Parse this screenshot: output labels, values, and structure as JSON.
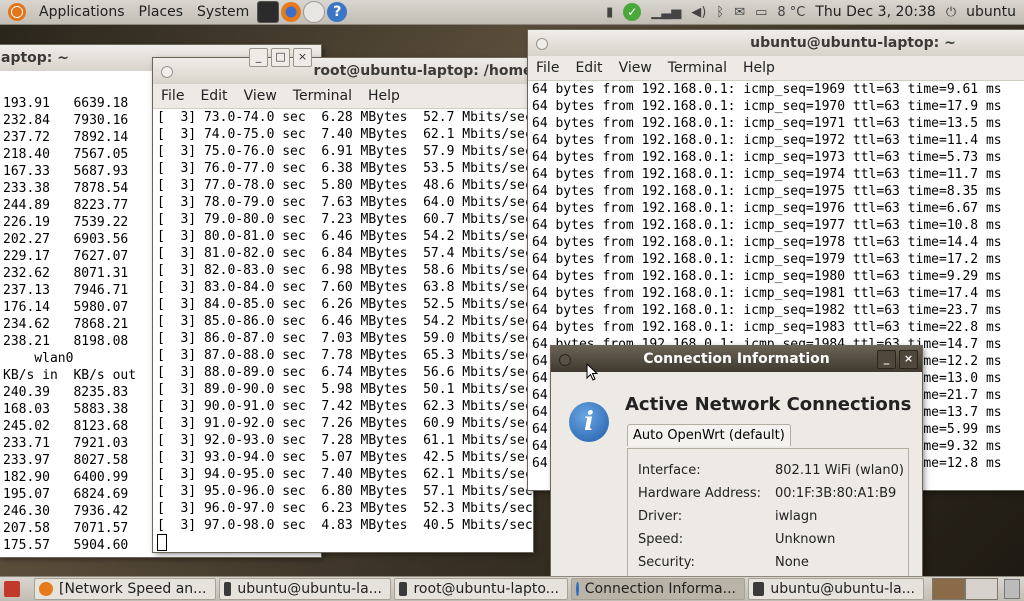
{
  "top_panel": {
    "menus": [
      "Applications",
      "Places",
      "System"
    ],
    "weather": "8 °C",
    "clock": "Thu Dec  3, 20:38",
    "user": "ubuntu"
  },
  "left_window": {
    "title": "aptop: ~",
    "lines": [
      "193.91   6639.18",
      "232.84   7930.16",
      "237.72   7892.14",
      "218.40   7567.05",
      "167.33   5687.93",
      "233.38   7878.54",
      "244.89   8223.77",
      "226.19   7539.22",
      "202.27   6903.56",
      "229.17   7627.07",
      "232.62   8071.31",
      "237.13   7946.71",
      "176.14   5980.07",
      "234.62   7868.21",
      "238.21   8198.08",
      "    wlan0",
      "KB/s in  KB/s out",
      "240.39   8235.83",
      "168.03   5883.38",
      "245.02   8123.68",
      "233.71   7921.03",
      "233.97   8027.58",
      "182.90   6400.99",
      "195.07   6824.69",
      "246.30   7936.42",
      "207.58   7071.57",
      "175.57   5904.60"
    ]
  },
  "middle_window": {
    "title": "root@ubuntu-laptop: /home",
    "menu": [
      "File",
      "Edit",
      "View",
      "Terminal",
      "Help"
    ],
    "lines": [
      "[  3] 73.0-74.0 sec  6.28 MBytes  52.7 Mbits/sec",
      "[  3] 74.0-75.0 sec  7.40 MBytes  62.1 Mbits/sec",
      "[  3] 75.0-76.0 sec  6.91 MBytes  57.9 Mbits/sec",
      "[  3] 76.0-77.0 sec  6.38 MBytes  53.5 Mbits/sec",
      "[  3] 77.0-78.0 sec  5.80 MBytes  48.6 Mbits/sec",
      "[  3] 78.0-79.0 sec  7.63 MBytes  64.0 Mbits/sec",
      "[  3] 79.0-80.0 sec  7.23 MBytes  60.7 Mbits/sec",
      "[  3] 80.0-81.0 sec  6.46 MBytes  54.2 Mbits/sec",
      "[  3] 81.0-82.0 sec  6.84 MBytes  57.4 Mbits/sec",
      "[  3] 82.0-83.0 sec  6.98 MBytes  58.6 Mbits/sec",
      "[  3] 83.0-84.0 sec  7.60 MBytes  63.8 Mbits/sec",
      "[  3] 84.0-85.0 sec  6.26 MBytes  52.5 Mbits/sec",
      "[  3] 85.0-86.0 sec  6.46 MBytes  54.2 Mbits/sec",
      "[  3] 86.0-87.0 sec  7.03 MBytes  59.0 Mbits/sec",
      "[  3] 87.0-88.0 sec  7.78 MBytes  65.3 Mbits/sec",
      "[  3] 88.0-89.0 sec  6.74 MBytes  56.6 Mbits/sec",
      "[  3] 89.0-90.0 sec  5.98 MBytes  50.1 Mbits/sec",
      "[  3] 90.0-91.0 sec  7.42 MBytes  62.3 Mbits/sec",
      "[  3] 91.0-92.0 sec  7.26 MBytes  60.9 Mbits/sec",
      "[  3] 92.0-93.0 sec  7.28 MBytes  61.1 Mbits/sec",
      "[  3] 93.0-94.0 sec  5.07 MBytes  42.5 Mbits/sec",
      "[  3] 94.0-95.0 sec  7.40 MBytes  62.1 Mbits/sec",
      "[  3] 95.0-96.0 sec  6.80 MBytes  57.1 Mbits/sec",
      "[  3] 96.0-97.0 sec  6.23 MBytes  52.3 Mbits/sec",
      "[  3] 97.0-98.0 sec  4.83 MBytes  40.5 Mbits/sec"
    ]
  },
  "right_window": {
    "title": "ubuntu@ubuntu-laptop: ~",
    "menu": [
      "File",
      "Edit",
      "View",
      "Terminal",
      "Help"
    ],
    "lines": [
      "64 bytes from 192.168.0.1: icmp_seq=1969 ttl=63 time=9.61 ms",
      "64 bytes from 192.168.0.1: icmp_seq=1970 ttl=63 time=17.9 ms",
      "64 bytes from 192.168.0.1: icmp_seq=1971 ttl=63 time=13.5 ms",
      "64 bytes from 192.168.0.1: icmp_seq=1972 ttl=63 time=11.4 ms",
      "64 bytes from 192.168.0.1: icmp_seq=1973 ttl=63 time=5.73 ms",
      "64 bytes from 192.168.0.1: icmp_seq=1974 ttl=63 time=11.7 ms",
      "64 bytes from 192.168.0.1: icmp_seq=1975 ttl=63 time=8.35 ms",
      "64 bytes from 192.168.0.1: icmp_seq=1976 ttl=63 time=6.67 ms",
      "64 bytes from 192.168.0.1: icmp_seq=1977 ttl=63 time=10.8 ms",
      "64 bytes from 192.168.0.1: icmp_seq=1978 ttl=63 time=14.4 ms",
      "64 bytes from 192.168.0.1: icmp_seq=1979 ttl=63 time=17.2 ms",
      "64 bytes from 192.168.0.1: icmp_seq=1980 ttl=63 time=9.29 ms",
      "64 bytes from 192.168.0.1: icmp_seq=1981 ttl=63 time=17.4 ms",
      "64 bytes from 192.168.0.1: icmp_seq=1982 ttl=63 time=23.7 ms",
      "64 bytes from 192.168.0.1: icmp_seq=1983 ttl=63 time=22.8 ms",
      "64 bytes from 192.168.0.1: icmp_seq=1984 ttl=63 time=14.7 ms",
      "64 bytes from 192.168.0.1: icmp_seq=1985 ttl=63 time=12.2 ms",
      "64 bytes from 192.168.0.1: icmp_seq=1986 ttl=63 time=13.0 ms",
      "64 bytes from 192.168.0.1: icmp_seq=1987 ttl=63 time=21.7 ms",
      "64 bytes from 192.168.0.1: icmp_seq=1988 ttl=63 time=13.7 ms",
      "64 bytes from 192.168.0.1: icmp_seq=1989 ttl=63 time=5.99 ms",
      "64 bytes from 192.168.0.1: icmp_seq=1990 ttl=63 time=9.32 ms",
      "64 bytes from 192.168.0.1: icmp_seq=1991 ttl=63 time=12.8 ms"
    ]
  },
  "dialog": {
    "title": "Connection Information",
    "heading": "Active Network Connections",
    "tab": "Auto OpenWrt (default)",
    "fields": [
      {
        "label": "Interface:",
        "value": "802.11 WiFi (wlan0)"
      },
      {
        "label": "Hardware Address:",
        "value": "00:1F:3B:80:A1:B9"
      },
      {
        "label": "Driver:",
        "value": "iwlagn"
      },
      {
        "label": "Speed:",
        "value": "Unknown"
      },
      {
        "label": "Security:",
        "value": "None"
      }
    ]
  },
  "taskbar": {
    "items": [
      "[Network Speed an...",
      "ubuntu@ubuntu-la...",
      "root@ubuntu-lapto...",
      "Connection Informa...",
      "ubuntu@ubuntu-la..."
    ]
  },
  "colors": {
    "panel": "#d6d2cb",
    "active_titlebar": "#4a4237",
    "info_blue": "#2f6fbe",
    "ubuntu_orange": "#e2761b"
  }
}
